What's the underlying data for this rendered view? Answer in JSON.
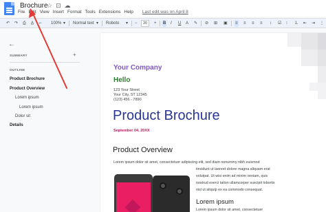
{
  "window": {
    "title": "Brochure",
    "icons": [
      "star-icon",
      "move-to-folder-icon",
      "cloud-status-icon"
    ]
  },
  "menu": {
    "items": [
      "File",
      "Edit",
      "View",
      "Insert",
      "Format",
      "Tools",
      "Extensions",
      "Help"
    ],
    "last_edit": "Last edit was on April 8"
  },
  "toolbar": {
    "zoom": "100%",
    "style": "Normal text",
    "font": "Roboto",
    "size": "20",
    "minus": "−",
    "plus": "+"
  },
  "sidebar": {
    "summary_label": "SUMMARY",
    "outline_label": "OUTLINE",
    "outline": [
      {
        "label": "Product Brochure",
        "bold": true
      },
      {
        "label": "Product Overview",
        "bold": true
      },
      {
        "label": "Lorem ipsum",
        "bold": false
      },
      {
        "label": "Lorem ipsum",
        "bold": false
      },
      {
        "label": "Dolor sit",
        "bold": false
      },
      {
        "label": "Details",
        "bold": true
      }
    ]
  },
  "document": {
    "company": "Your Company",
    "greeting": "Hello",
    "address_line1": "123 Your Street",
    "address_line2": "Your City, ST 12345",
    "phone": "(123) 456 - 7890",
    "title": "Product Brochure",
    "date": "September 04, 20XX",
    "overview_heading": "Product Overview",
    "overview_line1": "Lorem ipsum dolor sit amet, consectetuer adipiscing elit, sed diam nonummy nibh euismod",
    "overview_col": [
      "tincidunt ut laoreet dolore magna aliquam erat",
      "volutpat. Ut wisi enim ad minim veniam, quis",
      "nostrud exerci tation ullamcorper suscipit lobortis",
      "nisl ut aliquip ex ea commodo consequat."
    ],
    "lorem_heading": "Lorem ipsum",
    "lorem_line": "Lorem ipsum dolor sit amet, consectetuer"
  },
  "colors": {
    "company": "#7e57c2",
    "greeting": "#2e7d32",
    "title": "#283593",
    "date": "#c2185b",
    "annotation_arrow": "#e53935"
  }
}
